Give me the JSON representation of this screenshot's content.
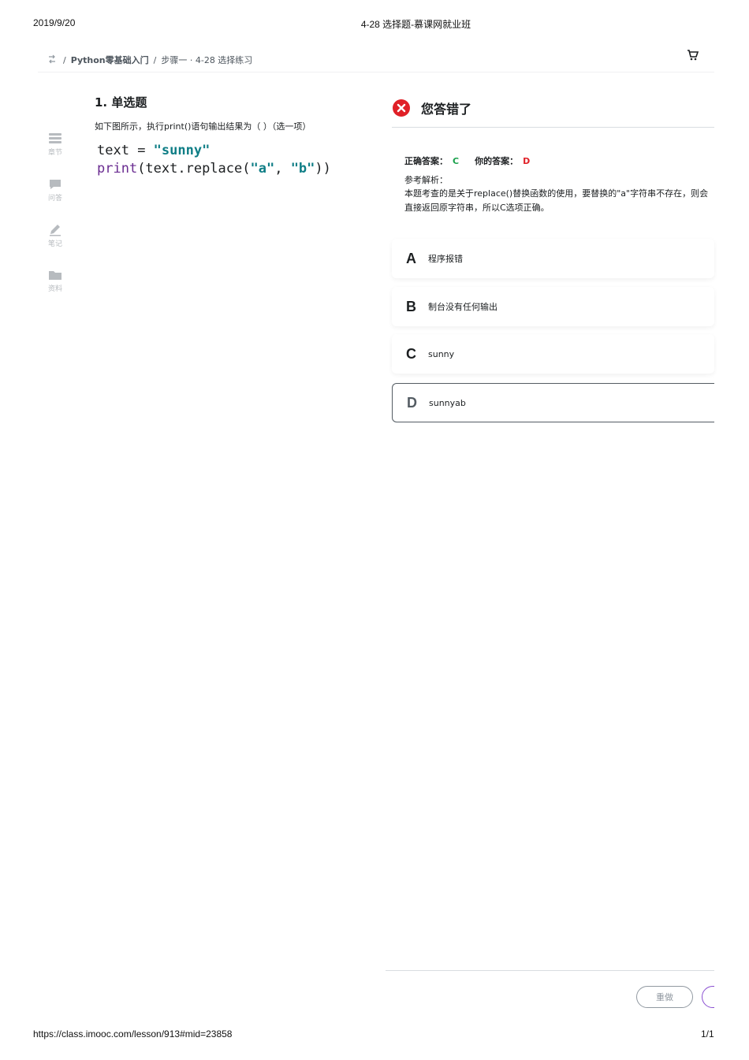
{
  "print_header": {
    "date": "2019/9/20",
    "title": "4-28 选择题-慕课网就业班"
  },
  "breadcrumb": {
    "course": "Python零基础入门",
    "lesson": "步骤一 · 4-28 选择练习",
    "separator": "/"
  },
  "sidebar": {
    "items": [
      {
        "label": "章节",
        "icon": "list-icon"
      },
      {
        "label": "问答",
        "icon": "chat-icon"
      },
      {
        "label": "笔记",
        "icon": "pencil-icon"
      },
      {
        "label": "资料",
        "icon": "folder-icon"
      }
    ]
  },
  "question": {
    "title": "1. 单选题",
    "description": "如下图所示，执行print()语句输出结果为（ ）（选一项）",
    "code_line1": {
      "var": "text",
      "op": " = ",
      "str": "\"sunny\""
    },
    "code_line2": {
      "fn": "print",
      "p1": "(text.replace(",
      "a1": "\"a\"",
      "comma": ", ",
      "a2": "\"b\"",
      "p2": "))"
    }
  },
  "result": {
    "title": "您答错了",
    "correct_label": "正确答案：",
    "correct_value": "C",
    "yours_label": "你的答案：",
    "yours_value": "D",
    "explanation_label": "参考解析：",
    "explanation": "本题考查的是关于replace()替换函数的使用，要替换的\"a\"字符串不存在，则会直接返回原字符串，所以C选项正确。"
  },
  "options": [
    {
      "letter": "A",
      "text": "程序报错"
    },
    {
      "letter": "B",
      "text": "制台没有任何输出"
    },
    {
      "letter": "C",
      "text": "sunny"
    },
    {
      "letter": "D",
      "text": "sunnyab"
    }
  ],
  "footer_buttons": {
    "redo": "重做"
  },
  "print_footer": {
    "url": "https://class.imooc.com/lesson/913#mid=23858",
    "page": "1/1"
  },
  "colors": {
    "error": "#e02027",
    "correct": "#19a04b",
    "string": "#0f7e86",
    "accent_purple": "#8a4fd1"
  }
}
